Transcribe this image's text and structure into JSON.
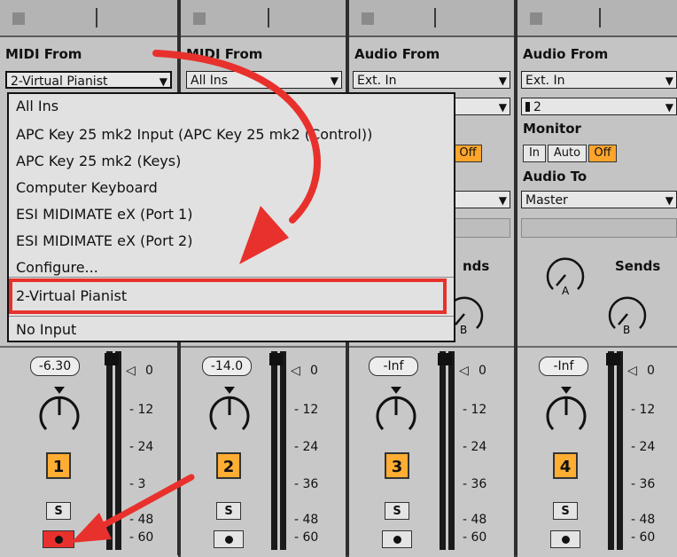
{
  "tracks": [
    {
      "header": "MIDI From",
      "source": "2-Virtual Pianist",
      "volume": "-6.30",
      "number": "1",
      "solo": "S",
      "armed": true
    },
    {
      "header": "MIDI From",
      "source": "All Ins",
      "volume": "-14.0",
      "number": "2",
      "solo": "S",
      "armed": false
    },
    {
      "header": "Audio From",
      "source": "Ext. In",
      "channel": "",
      "volume": "-Inf",
      "number": "3",
      "solo": "S",
      "armed": false,
      "monitor_off": "Off"
    },
    {
      "header": "Audio From",
      "source": "Ext. In",
      "channel": "2",
      "volume": "-Inf",
      "number": "4",
      "solo": "S",
      "armed": false,
      "monitor_label": "Monitor",
      "monitor_in": "In",
      "monitor_auto": "Auto",
      "monitor_off": "Off",
      "audio_to_label": "Audio To",
      "audio_to": "Master",
      "sends": "Sends",
      "knob_a": "A",
      "knob_b": "B"
    }
  ],
  "track3_sends_partial": "nds",
  "track3_knob_b": "B",
  "meter_ticks": [
    "0",
    "12",
    "24",
    "36",
    "48",
    "60"
  ],
  "meter_tick_partial": "3",
  "menu_items": [
    "All Ins",
    "APC Key 25 mk2 Input (APC Key 25 mk2 (Control))",
    "APC Key 25 mk2 (Keys)",
    "Computer Keyboard",
    "ESI MIDIMATE eX (Port 1)",
    "ESI MIDIMATE eX (Port 2)",
    "Configure...",
    "2-Virtual Pianist",
    "No Input"
  ],
  "highlight_color": "#e8312c",
  "accent_orange": "#ffae33"
}
